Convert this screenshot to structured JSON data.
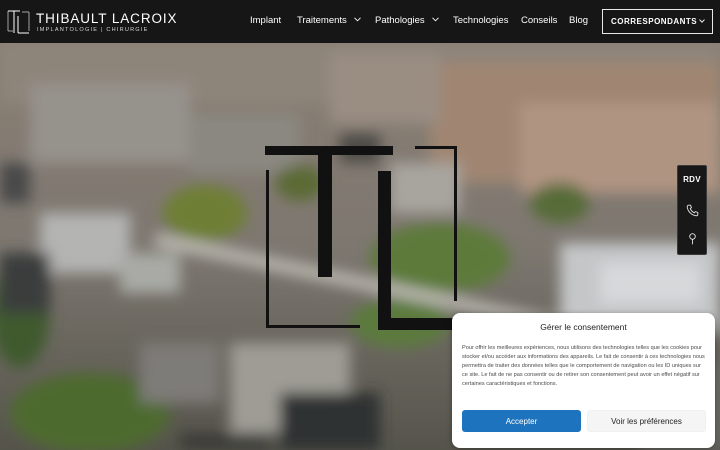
{
  "brand": {
    "name": "THIBAULT LACROIX",
    "tagline": "IMPLANTOLOGIE | CHIRURGIE",
    "logo_icon": "tl-monogram-icon"
  },
  "nav": {
    "items": [
      {
        "label": "Implant",
        "has_dropdown": false
      },
      {
        "label": "Traitements",
        "has_dropdown": true
      },
      {
        "label": "Pathologies",
        "has_dropdown": true
      },
      {
        "label": "Technologies",
        "has_dropdown": false
      },
      {
        "label": "Conseils",
        "has_dropdown": false
      },
      {
        "label": "Blog",
        "has_dropdown": false
      }
    ],
    "cta_label": "CORRESPONDANTS"
  },
  "side_widget": {
    "rdv_label": "RDV",
    "icons": [
      "phone-icon",
      "map-pin-icon"
    ]
  },
  "consent": {
    "title": "Gérer le consentement",
    "text": "Pour offrir les meilleures expériences, nous utilisons des technologies telles que les cookies pour stocker et/ou accéder aux informations des appareils. Le fait de consentir à ces technologies nous permettra de traiter des données telles que le comportement de navigation ou les ID uniques sur ce site. Le fait de ne pas consentir ou de retirer son consentement peut avoir un effet négatif sur certaines caractéristiques et fonctions.",
    "accept_label": "Accepter",
    "prefs_label": "Voir les préférences"
  },
  "colors": {
    "header_bg": "#161616",
    "accept_button": "#1e73be",
    "prefs_button": "#f5f5f5",
    "monogram": "#111111"
  }
}
